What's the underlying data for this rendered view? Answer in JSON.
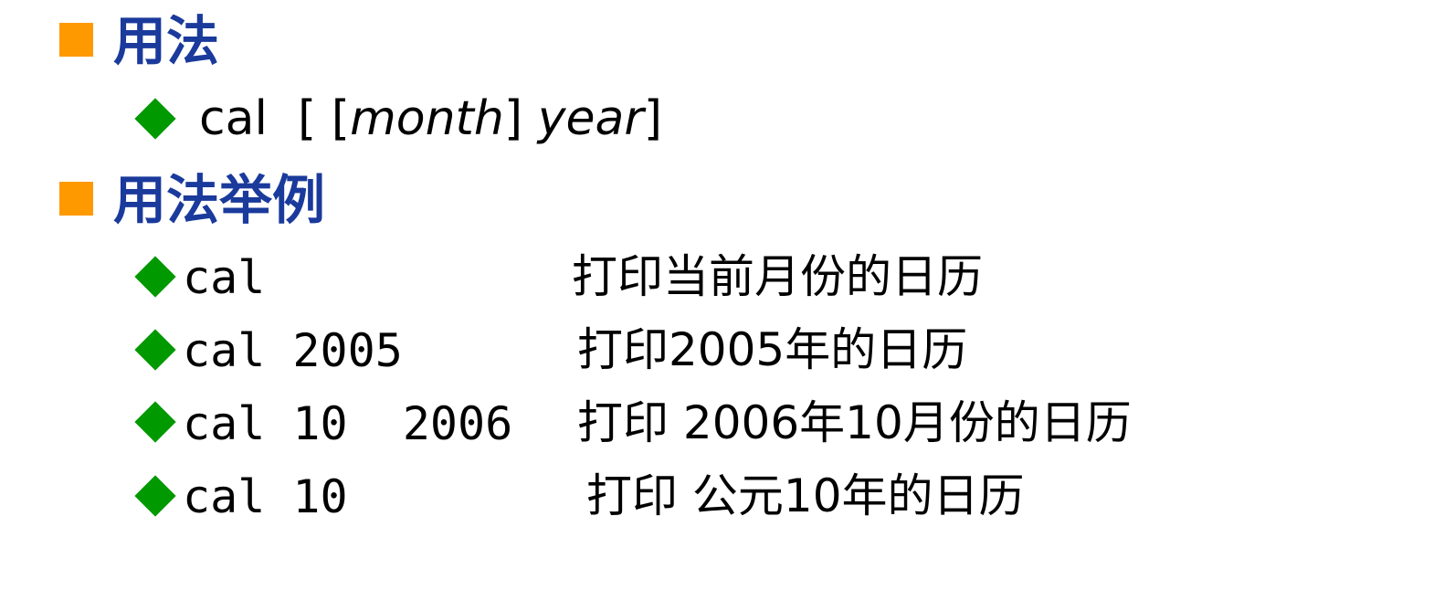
{
  "sections": [
    {
      "heading": "用法",
      "syntax": {
        "command": "cal",
        "open_outer": "[",
        "open_inner": "[",
        "month": "month",
        "close_inner": "]",
        "year": "year",
        "close_outer": "]"
      }
    },
    {
      "heading": "用法举例",
      "examples": [
        {
          "command": "cal",
          "description": "打印当前月份的日历"
        },
        {
          "command": "cal 2005",
          "description": "打印2005年的日历"
        },
        {
          "command": "cal 10  2006",
          "description": "打印 2006年10月份的日历"
        },
        {
          "command": "cal 10",
          "description": "打印 公元10年的日历"
        }
      ]
    }
  ],
  "colors": {
    "heading": "#1a3a9c",
    "square_bullet": "#ff9900",
    "diamond_bullet": "#009900"
  }
}
